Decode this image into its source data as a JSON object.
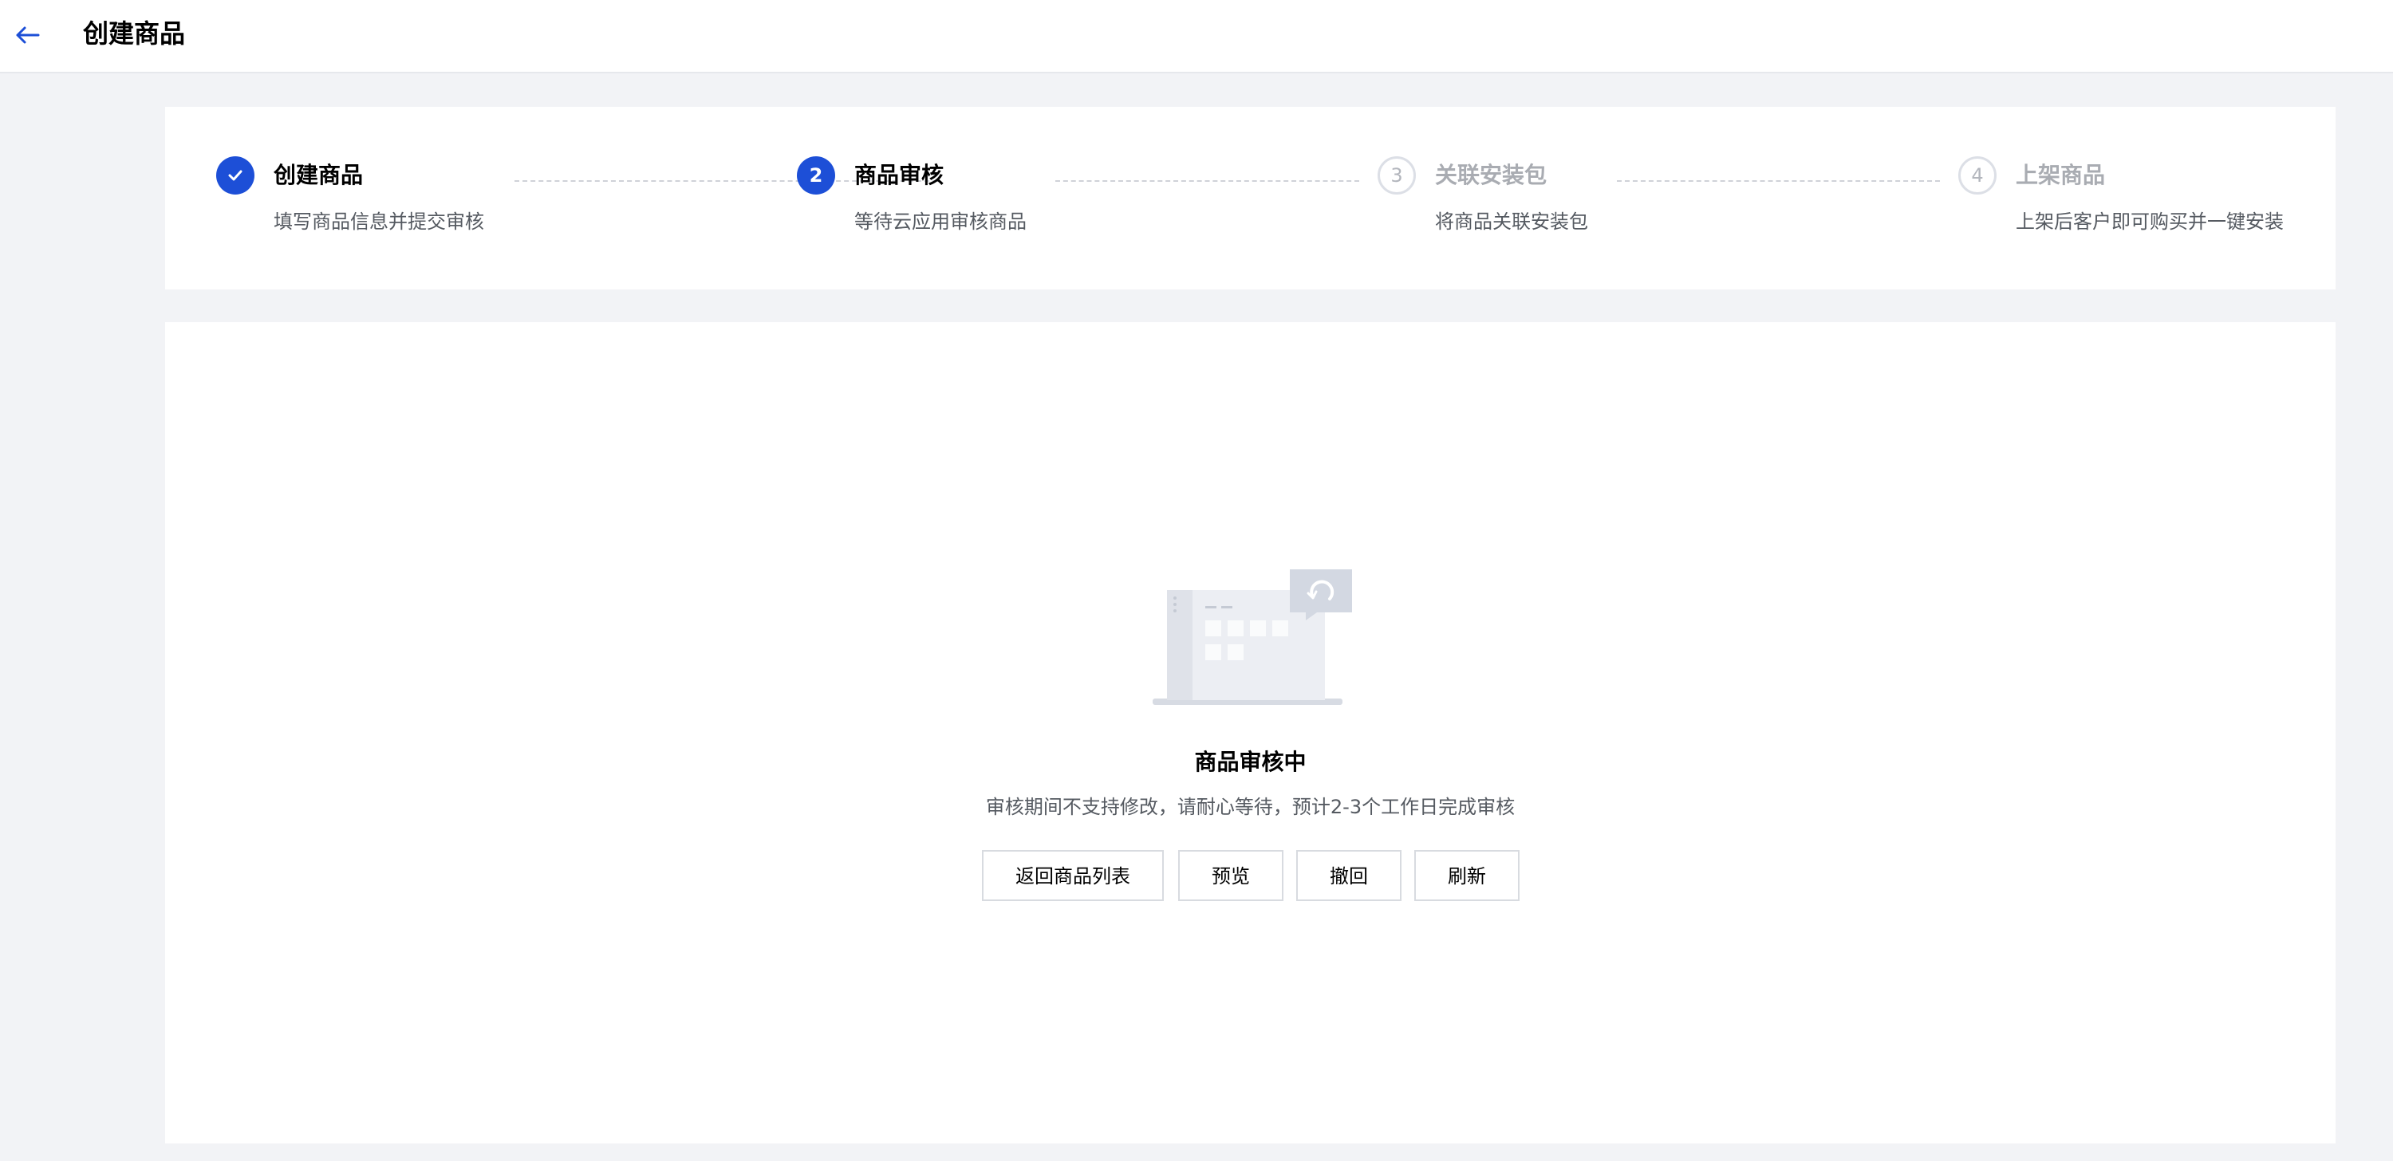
{
  "header": {
    "title": "创建商品",
    "back_icon": "arrow-left-icon",
    "accent": "#1d4fd7"
  },
  "steps": [
    {
      "index": "",
      "status": "done",
      "title": "创建商品",
      "description": "填写商品信息并提交审核",
      "icon": "check-icon"
    },
    {
      "index": "2",
      "status": "active",
      "title": "商品审核",
      "description": "等待云应用审核商品"
    },
    {
      "index": "3",
      "status": "todo",
      "title": "关联安装包",
      "description": "将商品关联安装包"
    },
    {
      "index": "4",
      "status": "todo",
      "title": "上架商品",
      "description": "上架后客户即可购买并一键安装"
    }
  ],
  "review": {
    "illustration_icon": "review-pending-illustration",
    "title": "商品审核中",
    "description": "审核期间不支持修改，请耐心等待，预计2-3个工作日完成审核",
    "buttons": {
      "back_to_list": "返回商品列表",
      "preview": "预览",
      "withdraw": "撤回",
      "refresh": "刷新"
    }
  }
}
